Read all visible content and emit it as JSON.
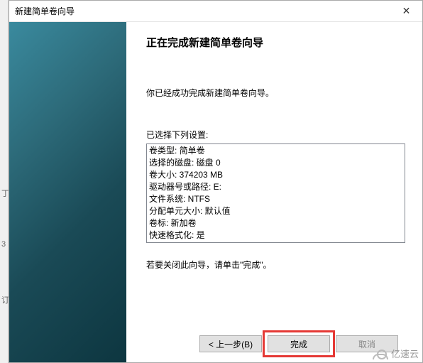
{
  "window": {
    "title": "新建简单卷向导"
  },
  "main": {
    "heading": "正在完成新建简单卷向导",
    "subtext": "你已经成功完成新建简单卷向导。",
    "settings_label": "已选择下列设置:",
    "settings": [
      "卷类型: 简单卷",
      "选择的磁盘: 磁盘 0",
      "卷大小: 374203 MB",
      "驱动器号或路径: E:",
      "文件系统: NTFS",
      "分配单元大小: 默认值",
      "卷标: 新加卷",
      "快速格式化: 是"
    ],
    "close_hint": "若要关闭此向导，请单击\"完成\"。"
  },
  "buttons": {
    "back": "< 上一步(B)",
    "finish": "完成",
    "cancel": "取消"
  },
  "watermark": {
    "text": "亿速云"
  },
  "left_markers": {
    "m1": "丁",
    "m2": "3",
    "m3": "订"
  }
}
